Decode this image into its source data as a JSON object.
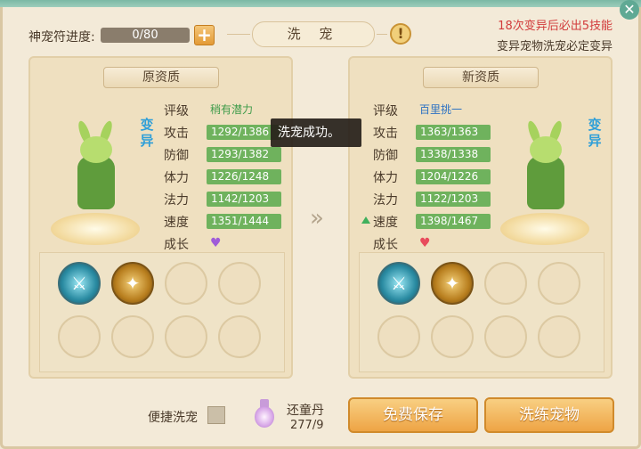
{
  "header": {
    "progress_label": "神宠符进度:",
    "progress_value": "0/80",
    "title": "洗 宠",
    "notice_1": "18次变异后必出5技能",
    "notice_2": "变异宠物洗宠必定变异"
  },
  "left": {
    "header": "原资质",
    "mutate": "变异",
    "stats": [
      {
        "label": "评级",
        "value": "稍有潜力"
      },
      {
        "label": "攻击",
        "value": "1292/1386"
      },
      {
        "label": "防御",
        "value": "1293/1382"
      },
      {
        "label": "体力",
        "value": "1226/1248"
      },
      {
        "label": "法力",
        "value": "1142/1203"
      },
      {
        "label": "速度",
        "value": "1351/1444"
      },
      {
        "label": "成长",
        "value": ""
      }
    ],
    "growth_icon": "purple-heart-icon",
    "skills": [
      "sword-skill-icon",
      "golden-beast-skill-icon"
    ]
  },
  "right": {
    "header": "新资质",
    "mutate": "变异",
    "stats": [
      {
        "label": "评级",
        "value": "百里挑一"
      },
      {
        "label": "攻击",
        "value": "1363/1363"
      },
      {
        "label": "防御",
        "value": "1338/1338"
      },
      {
        "label": "体力",
        "value": "1204/1226"
      },
      {
        "label": "法力",
        "value": "1122/1203"
      },
      {
        "label": "速度",
        "value": "1398/1467"
      },
      {
        "label": "成长",
        "value": ""
      }
    ],
    "growth_icon": "red-heart-icon",
    "skills": [
      "sword-skill-icon",
      "golden-beast-skill-icon"
    ]
  },
  "tooltip": "洗宠成功。",
  "footer": {
    "quick_label": "便捷洗宠",
    "potion_name": "还童丹",
    "potion_count": "277/9",
    "save_button": "免费保存",
    "wash_button": "洗练宠物"
  },
  "colors": {
    "stat_bar": "#6fb25d",
    "button": "#eea445",
    "notice_red": "#d23c3c",
    "mutate_blue": "#2f9fd8"
  }
}
